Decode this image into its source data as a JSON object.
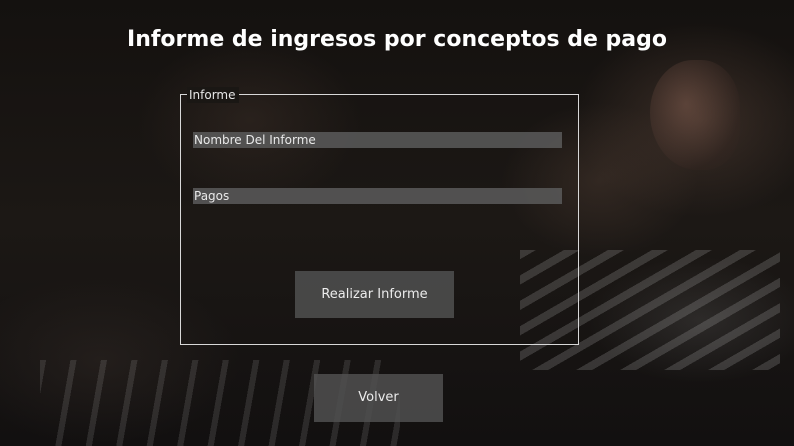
{
  "page": {
    "title": "Informe de ingresos por conceptos de pago"
  },
  "panel": {
    "legend": "Informe",
    "fields": {
      "nombre_informe": {
        "value": "Nombre Del Informe"
      },
      "pagos": {
        "value": "Pagos"
      }
    },
    "submit_label": "Realizar Informe"
  },
  "footer": {
    "back_label": "Volver"
  },
  "colors": {
    "background": "#171513",
    "text": "#ffffff",
    "field_bg": "#5a5a5a",
    "button_bg": "#505050",
    "panel_border": "#d8d8d8"
  }
}
